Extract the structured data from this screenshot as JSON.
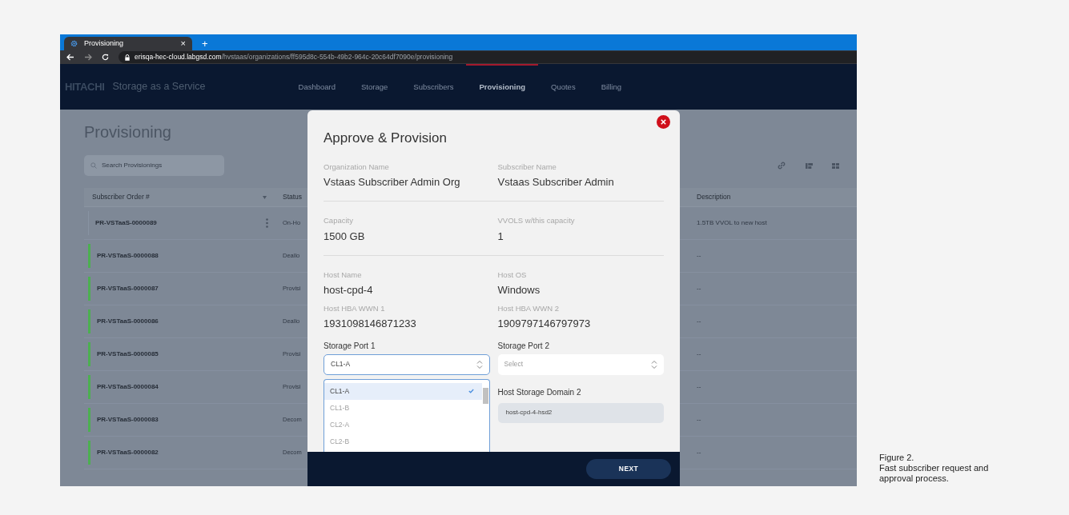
{
  "browser": {
    "tab": {
      "title": "Provisioning",
      "close": "×"
    },
    "new_tab": "+",
    "url": {
      "host": "erisqa-hec-cloud.labgsd.com",
      "path": "/hvstaas/organizations/ff595d8c-554b-49b2-964c-20c64df7090e/provisioning"
    }
  },
  "header": {
    "brand": "HITACHI",
    "product": "Storage as a Service",
    "nav": [
      {
        "label": "Dashboard",
        "selected": false
      },
      {
        "label": "Storage",
        "selected": false
      },
      {
        "label": "Subscribers",
        "selected": false
      },
      {
        "label": "Provisioning",
        "selected": true
      },
      {
        "label": "Quotes",
        "selected": false
      },
      {
        "label": "Billing",
        "selected": false
      }
    ]
  },
  "page": {
    "title": "Provisioning",
    "search": {
      "placeholder": "Search Provisionings"
    },
    "table": {
      "columns": [
        "Subscriber Order #",
        "Status",
        "Description"
      ],
      "rows": [
        {
          "order": "PR-VSTaaS-0000089",
          "status": "On-Ho",
          "description": "1.5TB VVOL to new host",
          "color": "#8893a3",
          "menu": true
        },
        {
          "order": "PR-VSTaaS-0000088",
          "status": "Deallo",
          "description": "--",
          "color": "#4caf50",
          "menu": false
        },
        {
          "order": "PR-VSTaaS-0000087",
          "status": "Provisi",
          "description": "--",
          "color": "#4caf50",
          "menu": false
        },
        {
          "order": "PR-VSTaaS-0000086",
          "status": "Deallo",
          "description": "--",
          "color": "#4caf50",
          "menu": false
        },
        {
          "order": "PR-VSTaaS-0000085",
          "status": "Provisi",
          "description": "--",
          "color": "#4caf50",
          "menu": false
        },
        {
          "order": "PR-VSTaaS-0000084",
          "status": "Provisi",
          "description": "--",
          "color": "#4caf50",
          "menu": false
        },
        {
          "order": "PR-VSTaaS-0000083",
          "status": "Decom",
          "description": "--",
          "color": "#4caf50",
          "menu": false
        },
        {
          "order": "PR-VSTaaS-0000082",
          "status": "Decom",
          "description": "--",
          "color": "#4caf50",
          "menu": false
        }
      ]
    }
  },
  "modal": {
    "title": "Approve & Provision",
    "sections": [
      [
        {
          "label": "Organization Name",
          "value": "Vstaas Subscriber Admin Org"
        },
        {
          "label": "Subscriber Name",
          "value": "Vstaas Subscriber Admin"
        }
      ],
      [
        {
          "label": "Capacity",
          "value": "1500 GB"
        },
        {
          "label": "VVOLS w/this capacity",
          "value": "1"
        }
      ],
      [
        {
          "label": "Host Name",
          "value": "host-cpd-4"
        },
        {
          "label": "Host OS",
          "value": "Windows"
        },
        {
          "label": "Host HBA WWN 1",
          "value": "1931098146871233"
        },
        {
          "label": "Host HBA WWN 2",
          "value": "1909797146797973"
        }
      ]
    ],
    "port1": {
      "label": "Storage Port 1",
      "value": "CL1-A",
      "expanded": true,
      "options": [
        {
          "label": "CL1-A",
          "selected": true
        },
        {
          "label": "CL1-B",
          "selected": false
        },
        {
          "label": "CL2-A",
          "selected": false
        },
        {
          "label": "CL2-B",
          "selected": false
        }
      ]
    },
    "port2": {
      "label": "Storage Port 2",
      "placeholder": "Select"
    },
    "domain2": {
      "label": "Host Storage Domain 2",
      "value": "host-cpd-4-hsd2"
    },
    "button": "NEXT"
  },
  "caption": {
    "figure": "Figure 2.",
    "text": "Fast subscriber request and approval process."
  }
}
